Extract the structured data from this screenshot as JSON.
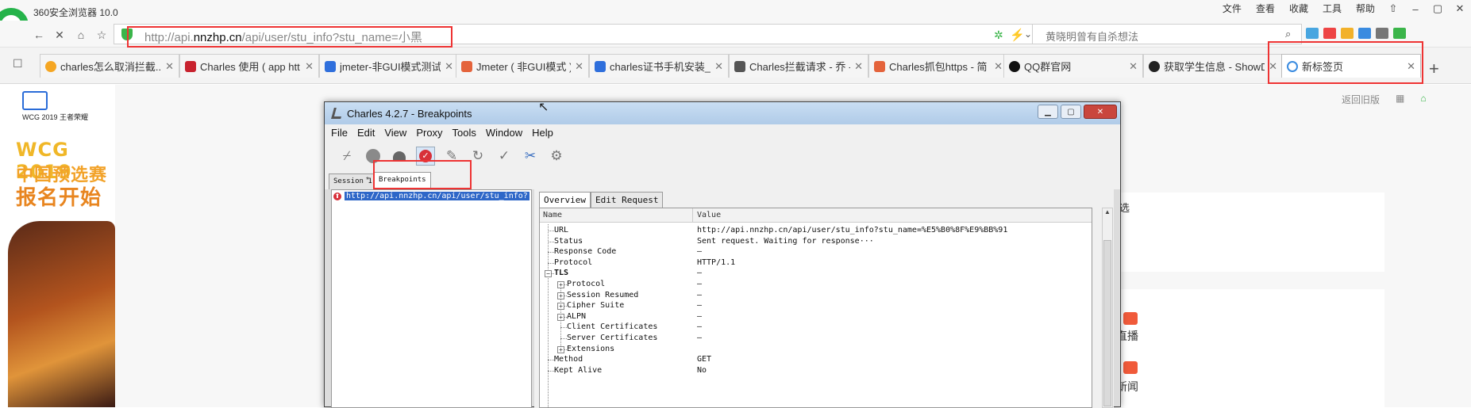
{
  "browser": {
    "app_title": "360安全浏览器 10.0",
    "menu": [
      "文件",
      "查看",
      "收藏",
      "工具",
      "帮助"
    ],
    "window_controls": [
      "pin-icon",
      "minimize",
      "maximize",
      "close"
    ],
    "address_url_prefix": "http://api.",
    "address_url_domain": "nnzhp.cn",
    "address_url_path": "/api/user/stu_info?stu_name=小黑",
    "search_text": "黄晓明曾有自杀想法",
    "tabs": [
      {
        "title": "charles怎么取消拦截...",
        "fav_color": "#f5a623"
      },
      {
        "title": "Charles 使用 ( app htt",
        "fav_color": "#c8222e"
      },
      {
        "title": "jmeter-非GUI模式测试",
        "fav_color": "#2f6fdc"
      },
      {
        "title": "Jmeter ( 非GUI模式 )",
        "fav_color": "#e4633b"
      },
      {
        "title": "charles证书手机安装_...",
        "fav_color": "#2f6fdc"
      },
      {
        "title": "Charles拦截请求 - 乔 -",
        "fav_color": "#555555"
      },
      {
        "title": "Charles抓包https - 简",
        "fav_color": "#e4633b"
      },
      {
        "title": "QQ群官网",
        "fav_color": "#111111"
      },
      {
        "title": "获取学生信息 - ShowD",
        "fav_color": "#222222"
      },
      {
        "title": "新标签页",
        "fav_color": "#3a8be0"
      }
    ],
    "new_tab_symbol": "+"
  },
  "page": {
    "wcg_logo_text": "WCG 2019  王者荣耀",
    "wcg_line1": "WCG 2019",
    "wcg_line2": "中国预选赛",
    "wcg_line3": "报名开始",
    "back_old_version": "返回旧版",
    "right_text1": "选",
    "right_text2": "直播",
    "right_text3": "新闻"
  },
  "charles": {
    "title": "Charles 4.2.7 - Breakpoints",
    "menu": [
      "File",
      "Edit",
      "View",
      "Proxy",
      "Tools",
      "Window",
      "Help"
    ],
    "toolbar": [
      "broom-icon",
      "record-icon",
      "throttle-icon",
      "breakpoint-icon",
      "pen-icon",
      "refresh-icon",
      "check-icon",
      "tools-icon",
      "settings-icon"
    ],
    "session_tab": "Session 1",
    "session_tab_mark": "*",
    "breakpoints_tab": "Breakpoints",
    "left_item": "http://api.nnzhp.cn/api/user/stu_info?",
    "right_tabs": [
      "Overview",
      "Edit Request"
    ],
    "columns": {
      "name": "Name",
      "value": "Value"
    },
    "rows": [
      {
        "name": "URL",
        "value": "http://api.nnzhp.cn/api/user/stu_info?stu_name=%E5%B0%8F%E9%BB%91",
        "level": 0
      },
      {
        "name": "Status",
        "value": "Sent request. Waiting for response···",
        "level": 0
      },
      {
        "name": "Response Code",
        "value": "–",
        "level": 0
      },
      {
        "name": "Protocol",
        "value": "HTTP/1.1",
        "level": 0
      },
      {
        "name": "TLS",
        "value": "–",
        "level": 0,
        "expand": "−",
        "bold": true
      },
      {
        "name": "Protocol",
        "value": "–",
        "level": 1,
        "expand": "+"
      },
      {
        "name": "Session Resumed",
        "value": "–",
        "level": 1,
        "expand": "+"
      },
      {
        "name": "Cipher Suite",
        "value": "–",
        "level": 1,
        "expand": "+"
      },
      {
        "name": "ALPN",
        "value": "–",
        "level": 1,
        "expand": "+"
      },
      {
        "name": "Client Certificates",
        "value": "–",
        "level": 1
      },
      {
        "name": "Server Certificates",
        "value": "–",
        "level": 1
      },
      {
        "name": "Extensions",
        "value": "",
        "level": 1,
        "expand": "+"
      },
      {
        "name": "Method",
        "value": "GET",
        "level": 0
      },
      {
        "name": "Kept Alive",
        "value": "No",
        "level": 0
      }
    ]
  }
}
